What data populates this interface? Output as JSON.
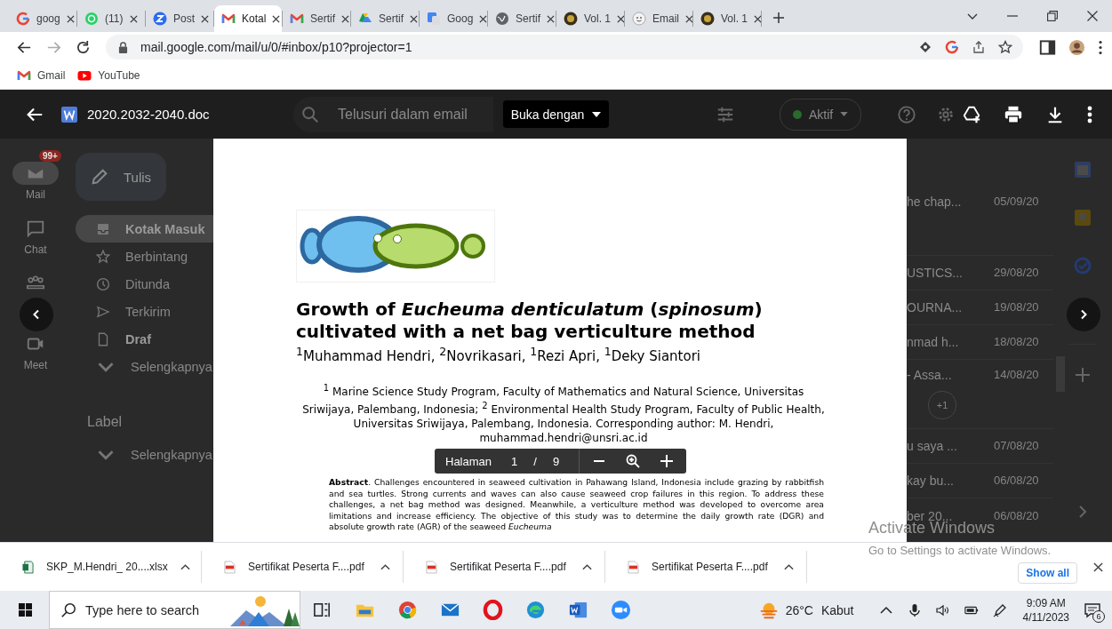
{
  "tabs": [
    {
      "title": "goog",
      "kind": "google",
      "selected": false
    },
    {
      "title": "(11)",
      "kind": "whatsapp",
      "selected": false
    },
    {
      "title": "Post",
      "kind": "zoom",
      "selected": false
    },
    {
      "title": "Kotal",
      "kind": "gmail",
      "selected": true
    },
    {
      "title": "Sertif",
      "kind": "gmail",
      "selected": false
    },
    {
      "title": "Sertif",
      "kind": "drive",
      "selected": false
    },
    {
      "title": "Goog",
      "kind": "translate",
      "selected": false
    },
    {
      "title": "Sertif",
      "kind": "globe",
      "selected": false
    },
    {
      "title": "Vol. 1",
      "kind": "seal",
      "selected": false
    },
    {
      "title": "Email",
      "kind": "face",
      "selected": false
    },
    {
      "title": "Vol. 1",
      "kind": "seal",
      "selected": false
    }
  ],
  "address_bar": {
    "url": "mail.google.com/mail/u/0/#inbox/p10?projector=1"
  },
  "bookmarks": [
    {
      "label": "Gmail",
      "kind": "gmail"
    },
    {
      "label": "YouTube",
      "kind": "youtube"
    }
  ],
  "gmail": {
    "search_placeholder": "Telusuri dalam email",
    "status": "Aktif",
    "compose": "Tulis",
    "rail": [
      {
        "label": "Mail",
        "kind": "mail",
        "badge": "99+",
        "selected": true
      },
      {
        "label": "Chat",
        "kind": "chat",
        "selected": false
      },
      {
        "kind": "spaces",
        "selected": false
      },
      {
        "label": "Meet",
        "kind": "meet",
        "selected": false
      }
    ],
    "folders": [
      {
        "label": "Kotak Masuk",
        "kind": "inbox",
        "selected": true,
        "unread": true
      },
      {
        "label": "Berbintang",
        "kind": "star",
        "selected": false,
        "unread": false
      },
      {
        "label": "Ditunda",
        "kind": "clock",
        "selected": false,
        "unread": false
      },
      {
        "label": "Terkirim",
        "kind": "send",
        "selected": false,
        "unread": false
      },
      {
        "label": "Draf",
        "kind": "file",
        "selected": false,
        "unread": true
      },
      {
        "label": "Selengkapnya",
        "kind": "chevron",
        "selected": false,
        "unread": false
      }
    ],
    "label_heading": "Label",
    "label_more": "Selengkapnya",
    "messages": [
      {
        "snippet": "he chap...",
        "date": "05/09/20"
      },
      {
        "snippet": "USTICS...",
        "date": "29/08/20"
      },
      {
        "snippet": "OURNA...",
        "date": "19/08/20"
      },
      {
        "snippet": "nmad h...",
        "date": "18/08/20"
      },
      {
        "snippet": "- Assa...",
        "date": "14/08/20",
        "chip": "+1"
      },
      {
        "snippet": "u saya ...",
        "date": "07/08/20"
      },
      {
        "snippet": "kay bu...",
        "date": "06/08/20"
      },
      {
        "snippet": "ber 20...",
        "date": "06/08/20"
      }
    ]
  },
  "viewer": {
    "file_name": "2020.2032-2040.doc",
    "open_with": "Buka dengan",
    "pager": {
      "label": "Halaman",
      "page": "1",
      "separator": "/",
      "total": "9"
    }
  },
  "document": {
    "title": "Growth of *Eucheuma denticulatum* (*spinosum*) cultivated with a net bag verticulture method",
    "authors": "$^{1}$Muhammad Hendri, $^{2}$Novrikasari, $^{1}$Rezi Apri, $^{1}$Deky Siantori",
    "affiliation": "$^{1}$ Marine Science Study Program, Faculty of Mathematics and Natural Science, Universitas Sriwijaya, Palembang, Indonesia; $^{2}$ Environmental Health Study Program, Faculty of Public Health, Universitas Sriwijaya, Palembang, Indonesia. Corresponding author: M. Hendri, muhammad.hendri@unsri.ac.id",
    "abstract": "**Abstract**. Challenges encountered in seaweed cultivation in Pahawang Island, Indonesia include grazing by rabbitfish and sea turtles. Strong currents and waves can also cause seaweed crop failures in this region. To address these challenges, a net bag method was designed. Meanwhile, a verticulture method was developed to overcome area limitations and increase efficiency. The objective of this study was to determine the daily growth rate (DGR) and absolute growth rate (AGR) of the seaweed *Eucheuma*"
  },
  "downloads": {
    "items": [
      {
        "name": "SKP_M.Hendri_ 20....xlsx",
        "kind": "spreadsheet"
      },
      {
        "name": "Sertifikat Peserta F....pdf",
        "kind": "pdf"
      },
      {
        "name": "Sertifikat Peserta F....pdf",
        "kind": "pdf"
      },
      {
        "name": "Sertifikat Peserta F....pdf",
        "kind": "pdf"
      }
    ],
    "show_all": "Show all"
  },
  "windows_notice": {
    "title": "Activate Windows",
    "message": "Go to Settings to activate Windows."
  },
  "taskbar": {
    "search_placeholder": "Type here to search",
    "weather": {
      "temperature": "26°C",
      "condition": "Kabut"
    },
    "clock": {
      "time": "9:09 AM",
      "date": "4/11/2023"
    },
    "notifications": "6"
  }
}
